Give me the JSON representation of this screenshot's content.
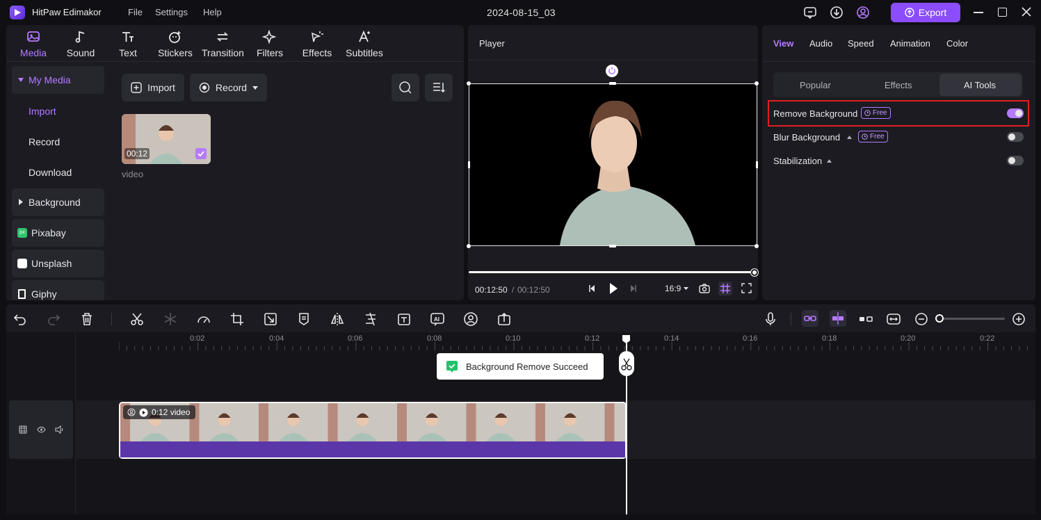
{
  "app": {
    "name": "HitPaw Edimakor",
    "document_title": "2024-08-15_03"
  },
  "menu": [
    "File",
    "Settings",
    "Help"
  ],
  "titlebar": {
    "export_label": "Export"
  },
  "categories": [
    {
      "label": "Media",
      "icon": "media-icon",
      "active": true
    },
    {
      "label": "Sound",
      "icon": "music-note-icon"
    },
    {
      "label": "Text",
      "icon": "text-icon"
    },
    {
      "label": "Stickers",
      "icon": "sticker-icon"
    },
    {
      "label": "Transition",
      "icon": "transition-icon"
    },
    {
      "label": "Filters",
      "icon": "filter-sparkle-icon"
    },
    {
      "label": "Effects",
      "icon": "effects-icon"
    },
    {
      "label": "Subtitles",
      "icon": "subtitles-icon"
    }
  ],
  "sidebar": {
    "my_media": "My Media",
    "sub_items": [
      "Import",
      "Record",
      "Download"
    ],
    "background": "Background",
    "pixabay": "Pixabay",
    "unsplash": "Unsplash",
    "giphy": "Giphy"
  },
  "media": {
    "import_label": "Import",
    "record_label": "Record",
    "items": [
      {
        "label": "video",
        "duration": "00:12"
      }
    ]
  },
  "player": {
    "title": "Player",
    "current_time": "00:12:50",
    "separator": "/",
    "total_time": "00:12:50",
    "aspect": "16:9",
    "progress": 1.0
  },
  "right_panel": {
    "tabs": [
      "View",
      "Audio",
      "Speed",
      "Animation",
      "Color"
    ],
    "segments": [
      "Popular",
      "Effects",
      "AI Tools"
    ],
    "props": [
      {
        "label": "Remove Background",
        "badge": "Free",
        "on": true
      },
      {
        "label": "Blur Background",
        "badge": "Free",
        "on": false
      },
      {
        "label": "Stabilization",
        "badge": "",
        "on": false
      }
    ]
  },
  "timeline": {
    "ruler": [
      "0:02",
      "0:04",
      "0:06",
      "0:08",
      "0:10",
      "0:12",
      "0:14",
      "0:16",
      "0:18",
      "0:20",
      "0:22"
    ],
    "clip_label": "0:12 video",
    "toast": "Background Remove Succeed"
  },
  "colors": {
    "accent": "#b57bff",
    "export": "#8b4dff",
    "audio_bar": "#5b36a8"
  }
}
